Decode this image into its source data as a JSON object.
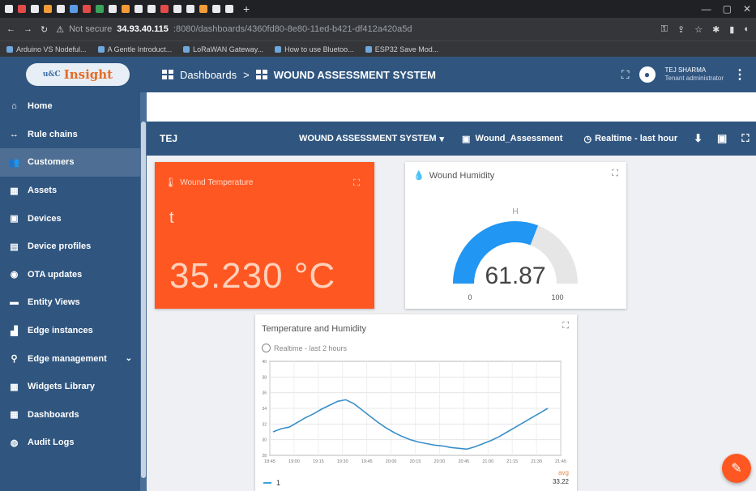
{
  "browser": {
    "tab_colors": [
      "#e8eaed",
      "#e34a4a",
      "#e8eaed",
      "#f29b38",
      "#e8eaed",
      "#5a9be6",
      "#e34a4a",
      "#3aa35a",
      "#e8eaed",
      "#f29b38",
      "#e8eaed",
      "#e8eaed",
      "#e34a4a",
      "#e8eaed",
      "#e8eaed",
      "#f29b38",
      "#e8eaed",
      "#e8eaed"
    ],
    "new_tab": "+",
    "not_secure": "Not secure",
    "url_host": "34.93.40.115",
    "url_path": ":8080/dashboards/4360fd80-8e80-11ed-b421-df412a420a5d",
    "bookmarks": [
      "Arduino VS Nodeful...",
      "A Gentle Introduct...",
      "LoRaWAN Gateway...",
      "How to use Bluetoo...",
      "ESP32 Save Mod..."
    ]
  },
  "header": {
    "logo_text": "Insight",
    "logo_prefix": "u&C",
    "breadcrumb_root": "Dashboards",
    "breadcrumb_sep": ">",
    "breadcrumb_current": "WOUND ASSESSMENT SYSTEM",
    "user_name": "TEJ SHARMA",
    "user_role": "Tenant administrator"
  },
  "sidebar": {
    "items": [
      {
        "label": "Home",
        "icon": "home-icon",
        "glyph": "⌂"
      },
      {
        "label": "Rule chains",
        "icon": "rule-chain-icon",
        "glyph": "↔"
      },
      {
        "label": "Customers",
        "icon": "customers-icon",
        "glyph": "👥"
      },
      {
        "label": "Assets",
        "icon": "assets-icon",
        "glyph": "▦"
      },
      {
        "label": "Devices",
        "icon": "devices-icon",
        "glyph": "▣"
      },
      {
        "label": "Device profiles",
        "icon": "device-profiles-icon",
        "glyph": "▤"
      },
      {
        "label": "OTA updates",
        "icon": "ota-icon",
        "glyph": "◉"
      },
      {
        "label": "Entity Views",
        "icon": "entity-views-icon",
        "glyph": "▬"
      },
      {
        "label": "Edge instances",
        "icon": "edge-instances-icon",
        "glyph": "▟"
      },
      {
        "label": "Edge management",
        "icon": "edge-management-icon",
        "glyph": "⚲"
      },
      {
        "label": "Widgets Library",
        "icon": "widgets-icon",
        "glyph": "▦"
      },
      {
        "label": "Dashboards",
        "icon": "dashboards-icon",
        "glyph": "▦"
      },
      {
        "label": "Audit Logs",
        "icon": "audit-logs-icon",
        "glyph": "◍"
      }
    ],
    "active_index": 2
  },
  "dashbar": {
    "name": "TEJ",
    "state": "WOUND ASSESSMENT SYSTEM",
    "entity": "Wound_Assessment",
    "timewindow": "Realtime - last hour"
  },
  "temperature_card": {
    "title": "Wound Temperature",
    "symbol": "t",
    "value": "35.230 °C"
  },
  "humidity_card": {
    "title": "Wound Humidity",
    "unit_label": "H",
    "value": "61.87",
    "min": "0",
    "max": "100",
    "fraction": 0.6187,
    "color": "#2196f3"
  },
  "chart_card": {
    "title": "Temperature and Humidity",
    "timewindow": "Realtime - last 2 hours",
    "legend_label": "1",
    "avg_label": "avg",
    "avg_value": "33.22"
  },
  "chart_data": {
    "type": "line",
    "title": "Temperature and Humidity",
    "xlabel": "",
    "ylabel": "",
    "y_ticks": [
      "40",
      "38",
      "36",
      "34",
      "32",
      "30",
      "28"
    ],
    "ylim": [
      28,
      40
    ],
    "x_ticks": [
      "18:45",
      "19:00",
      "19:15",
      "19:30",
      "19:45",
      "20:00",
      "20:15",
      "20:30",
      "20:45",
      "21:00",
      "21:15",
      "21:30",
      "21:45"
    ],
    "series": [
      {
        "color": "#3a8fc9",
        "x": [
          "18:47",
          "18:52",
          "18:57",
          "19:02",
          "19:07",
          "19:12",
          "19:17",
          "19:22",
          "19:27",
          "19:32",
          "19:37",
          "19:42",
          "19:47",
          "19:52",
          "19:57",
          "20:02",
          "20:07",
          "20:12",
          "20:17",
          "20:22",
          "20:27",
          "20:32",
          "20:37",
          "20:42",
          "20:47",
          "20:52",
          "20:57",
          "21:02",
          "21:07",
          "21:12",
          "21:17",
          "21:22",
          "21:27",
          "21:32",
          "21:37"
        ],
        "values": [
          31.0,
          31.4,
          31.6,
          32.2,
          32.8,
          33.3,
          33.9,
          34.4,
          34.9,
          35.1,
          34.6,
          33.8,
          33.0,
          32.2,
          31.5,
          30.9,
          30.4,
          30.0,
          29.7,
          29.5,
          29.3,
          29.2,
          29.0,
          28.9,
          28.8,
          29.1,
          29.5,
          29.9,
          30.4,
          31.0,
          31.6,
          32.2,
          32.8,
          33.4,
          34.0
        ]
      }
    ],
    "grid": true
  },
  "fab": {
    "icon": "edit-icon",
    "glyph": "✎"
  }
}
